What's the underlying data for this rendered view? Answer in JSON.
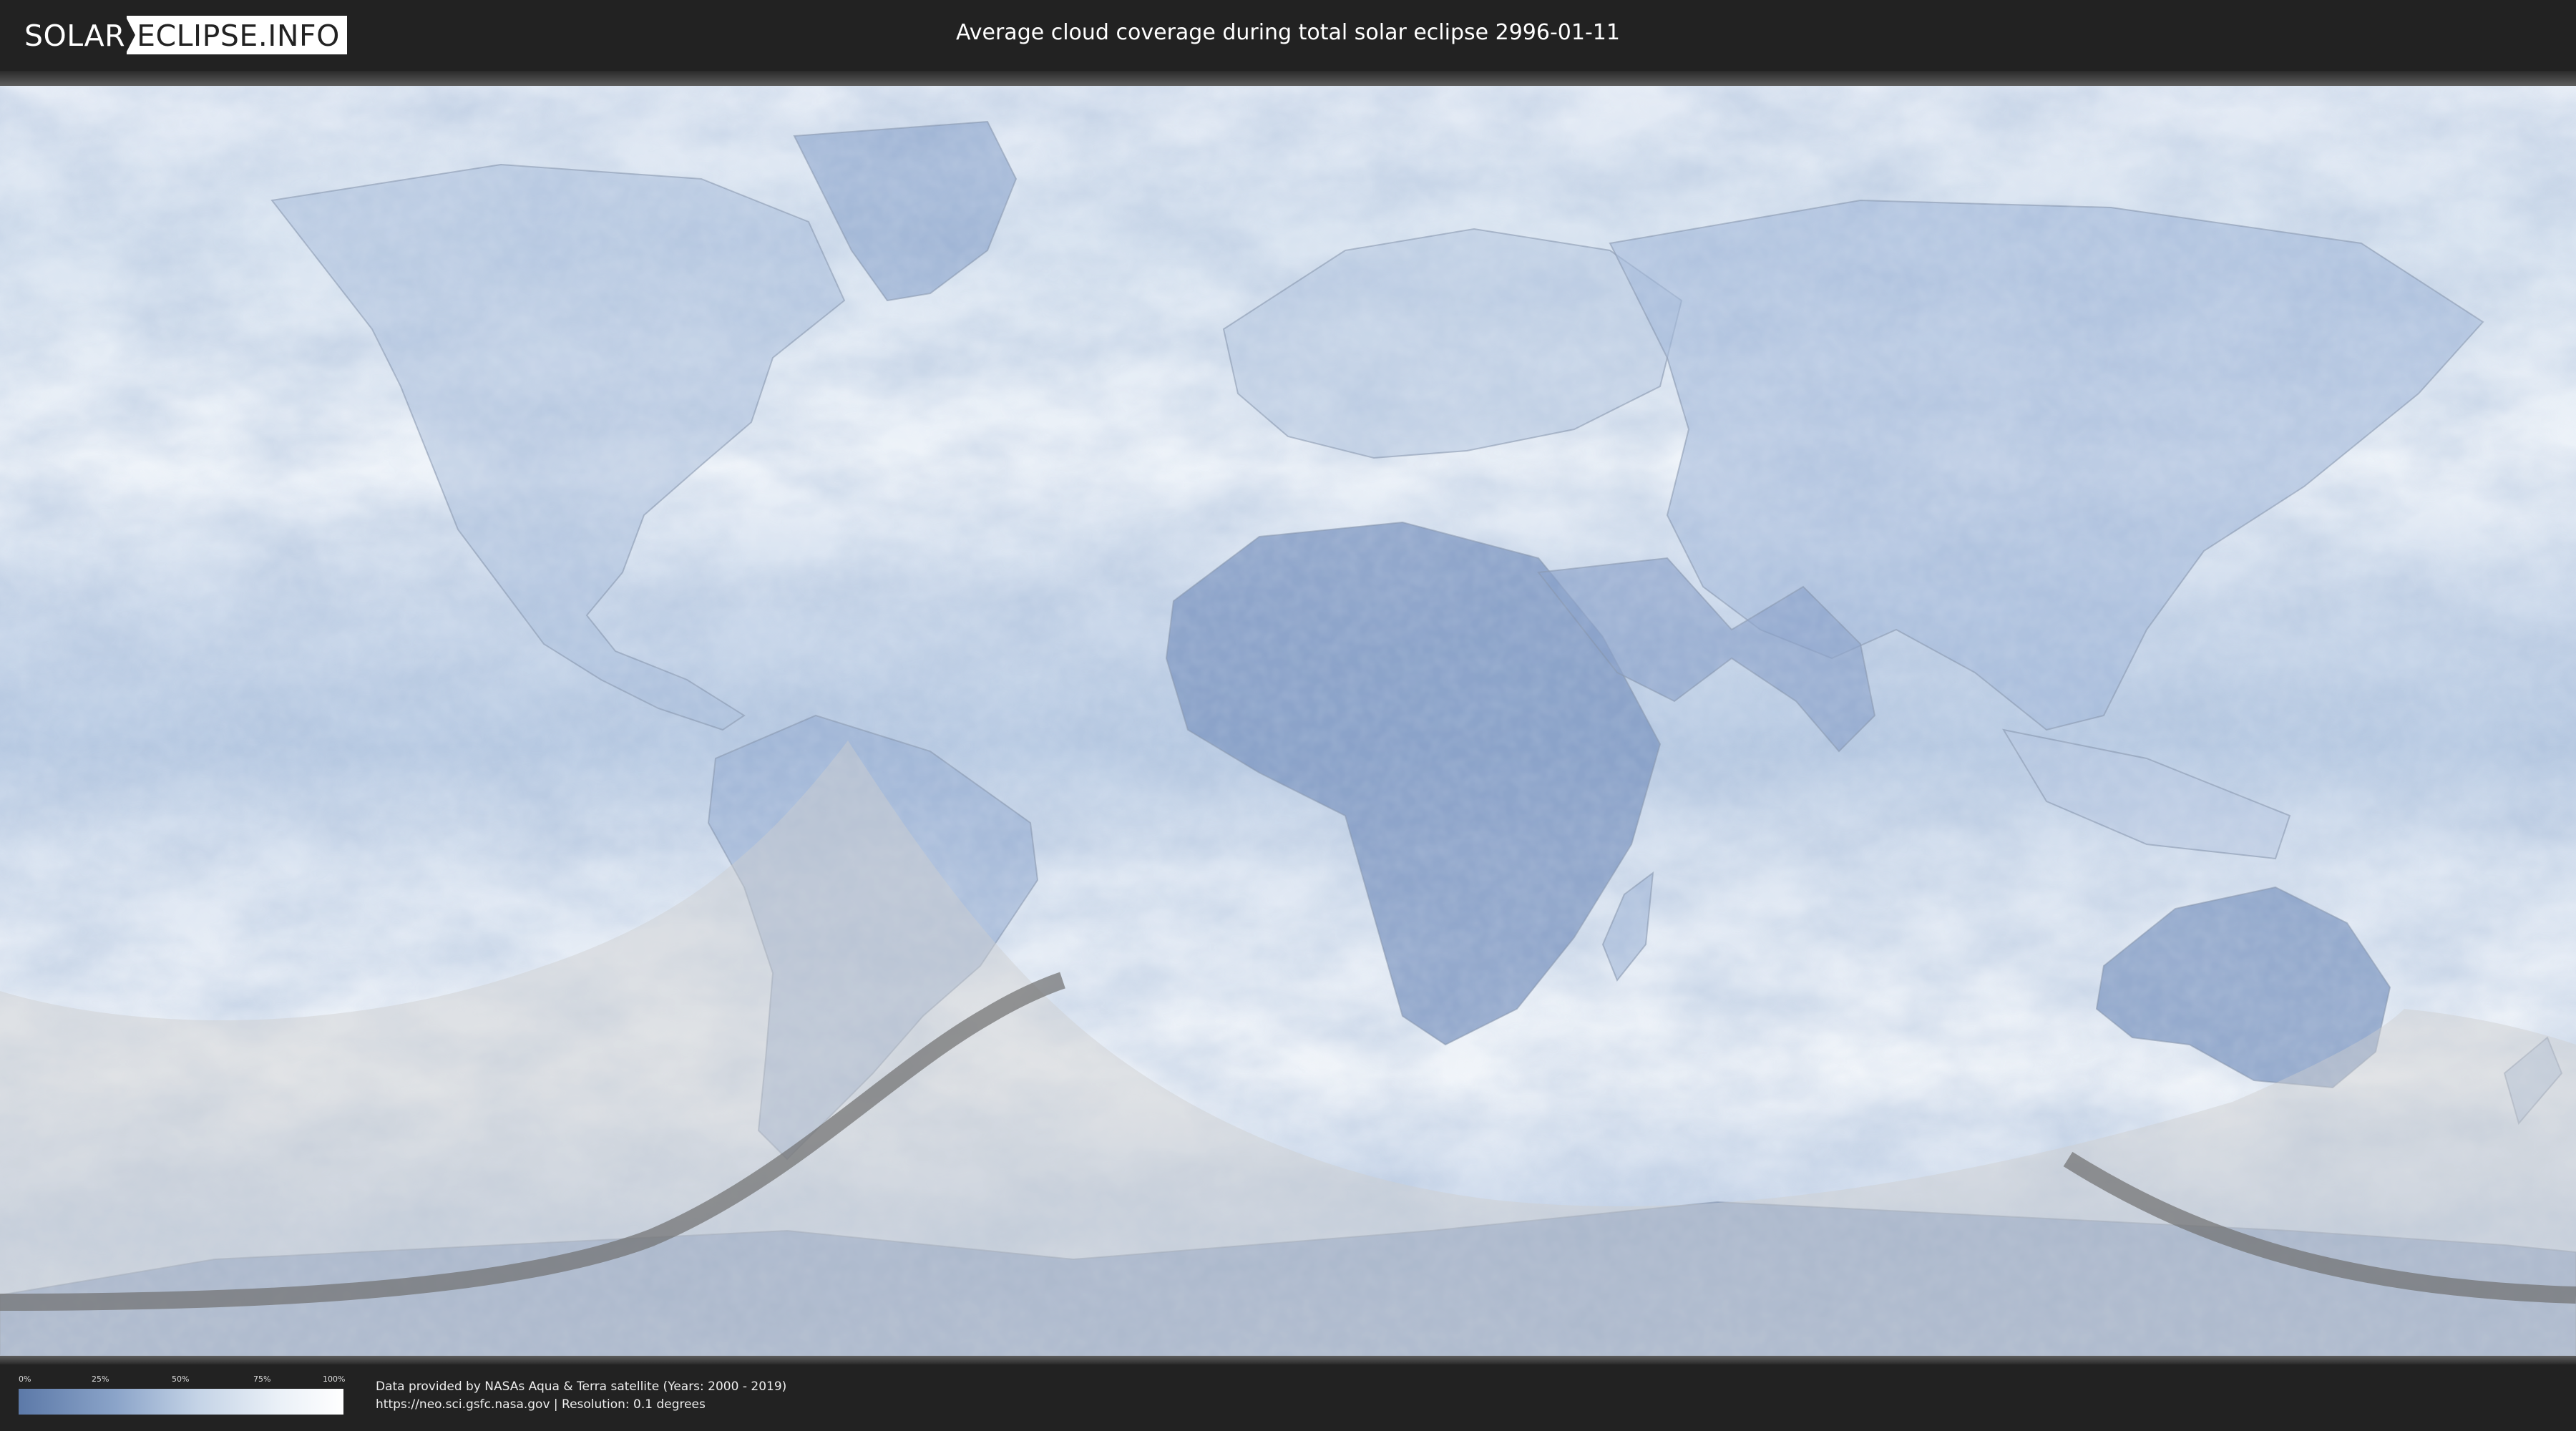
{
  "header": {
    "logo_left": "SOLAR",
    "logo_right": "ECLIPSE.INFO",
    "title": "Average cloud coverage during total solar eclipse 2996-01-11"
  },
  "legend": {
    "ticks": [
      "0%",
      "25%",
      "50%",
      "75%",
      "100%"
    ],
    "colors": {
      "low": "#5c79a8",
      "high": "#ffffff"
    }
  },
  "footer": {
    "credit_line1": "Data provided by NASAs Aqua & Terra satellite (Years: 2000 - 2019)",
    "credit_line2": "https://neo.sci.gsfc.nasa.gov | Resolution: 0.1 degrees"
  },
  "colors": {
    "background": "#222222",
    "cloud_dark": "#6a86b4",
    "cloud_light": "#f2f6fb",
    "eclipse_overlay": "#c8c8c8",
    "eclipse_path": "#7a7a7a"
  }
}
